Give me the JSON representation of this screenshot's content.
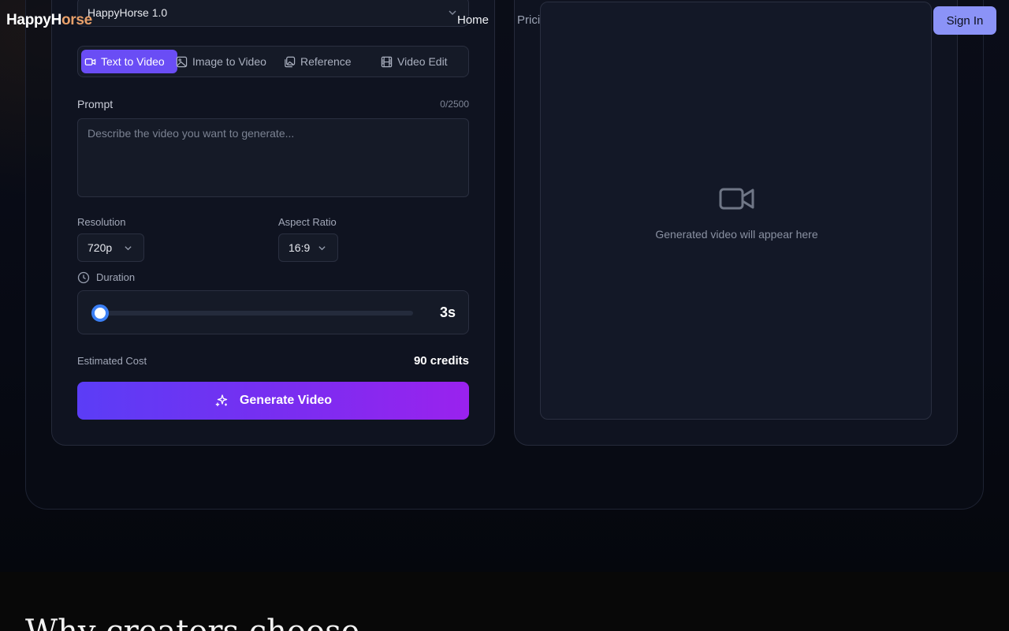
{
  "header": {
    "logo_part1": "HappyH",
    "logo_part2": "orse",
    "nav_home": "Home",
    "nav_pricing": "Pricing",
    "signin": "Sign In"
  },
  "generator": {
    "model_value": "HappyHorse 1.0",
    "tabs": [
      {
        "label": "Text to Video",
        "icon": "video-icon"
      },
      {
        "label": "Image to Video",
        "icon": "image-icon"
      },
      {
        "label": "Reference",
        "icon": "reference-icon"
      },
      {
        "label": "Video Edit",
        "icon": "film-icon"
      }
    ],
    "prompt_label": "Prompt",
    "prompt_counter": "0/2500",
    "prompt_placeholder": "Describe the video you want to generate...",
    "resolution_label": "Resolution",
    "resolution_value": "720p",
    "aspect_label": "Aspect Ratio",
    "aspect_value": "16:9",
    "duration_label": "Duration",
    "duration_value": "3s",
    "duration_fraction": 0,
    "cost_label": "Estimated Cost",
    "cost_value": "90 credits",
    "generate_label": "Generate Video"
  },
  "preview": {
    "empty_message": "Generated video will appear here"
  },
  "section": {
    "heading": "Why creators choose"
  },
  "colors": {
    "accent": "#6a4df5",
    "signin_bg": "#8b93f7",
    "logo_accent": "#e8a06a",
    "slider_thumb": "#3b7ff5"
  }
}
